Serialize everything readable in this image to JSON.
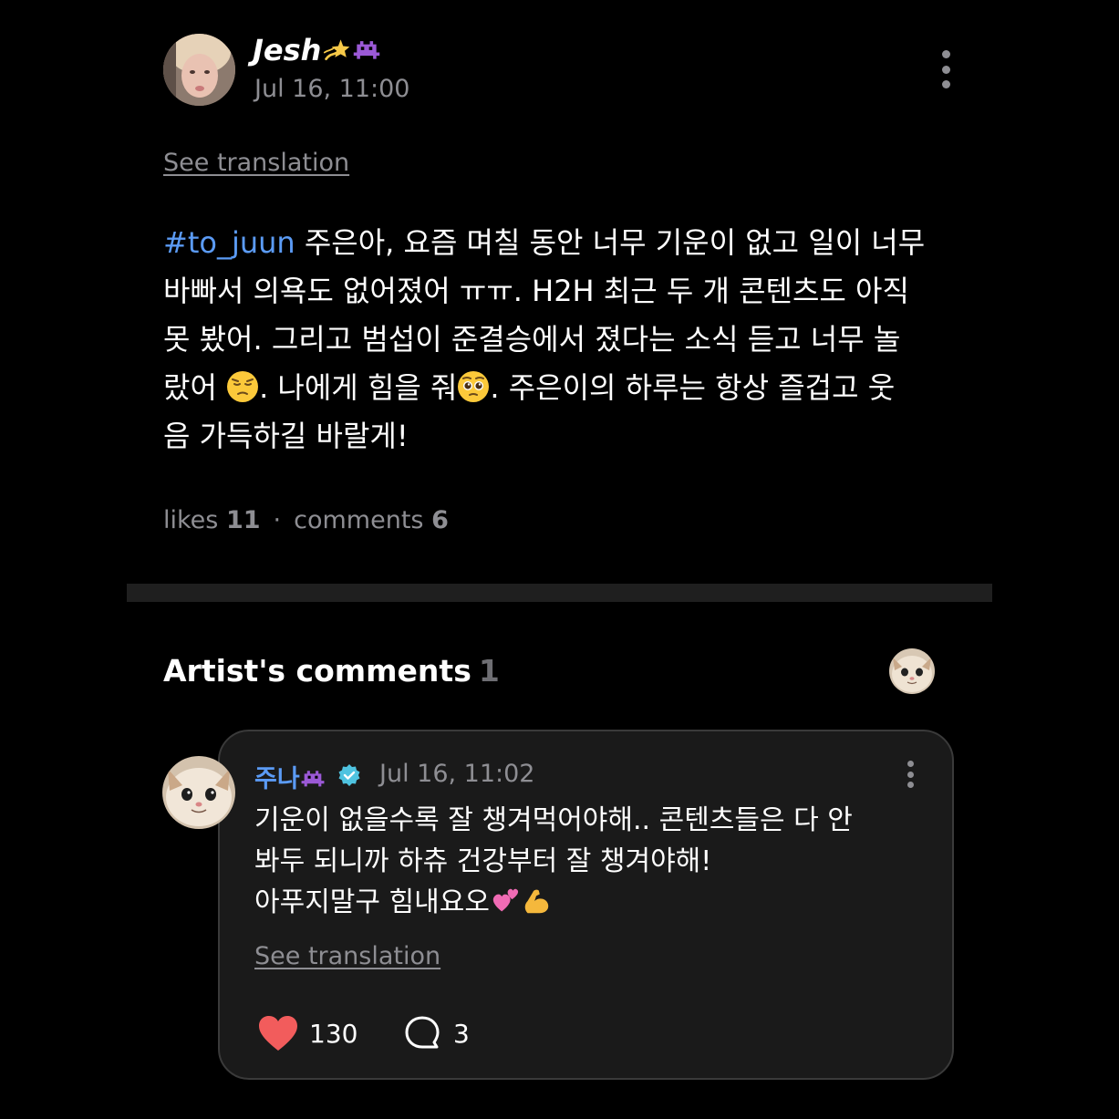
{
  "post": {
    "author": "Jesh",
    "author_emojis": [
      "dizzy-star",
      "alien-monster"
    ],
    "date": "Jul 16, 11:00",
    "see_translation": "See translation",
    "hashtag": "#to_juun",
    "lines": [
      " 주은아, 요즘 며칠 동안 너무 기운이 없고 일이 너무",
      "바빠서 의욕도 없어졌어 ㅠㅠ. H2H 최근 두 개 콘텐츠도 아직",
      "못 봤어. 그리고 범섭이 준결승에서 졌다는 소식 듣고 너무 놀",
      "랐어 ",
      ". 나에게 힘을 줘",
      ". 주은이의 하루는 항상 즐겁고 웃",
      "음 가득하길 바랄게!"
    ],
    "likes_label": "likes",
    "likes_count": "11",
    "stats_separator": "·",
    "comments_label": "comments",
    "comments_count": "6"
  },
  "artist_comments": {
    "title": "Artist's comments",
    "count": "1",
    "comment": {
      "author": "주나",
      "author_emoji": "alien-monster",
      "verified": true,
      "date": "Jul 16, 11:02",
      "lines": [
        "기운이 없을수록 잘 챙겨먹어야해.. 콘텐츠들은 다 안",
        "봐두 되니까 하츄 건강부터 잘 챙겨야해!",
        "아푸지말구 힘내요오"
      ],
      "trailing_emojis": [
        "two-hearts",
        "flexed-biceps"
      ],
      "see_translation": "See translation",
      "likes": "130",
      "replies": "3"
    }
  },
  "colors": {
    "background": "#000000",
    "accent": "#5b9bf5",
    "muted": "#8e8e93",
    "card": "#1a1a1a",
    "heart": "#f25c5c"
  }
}
